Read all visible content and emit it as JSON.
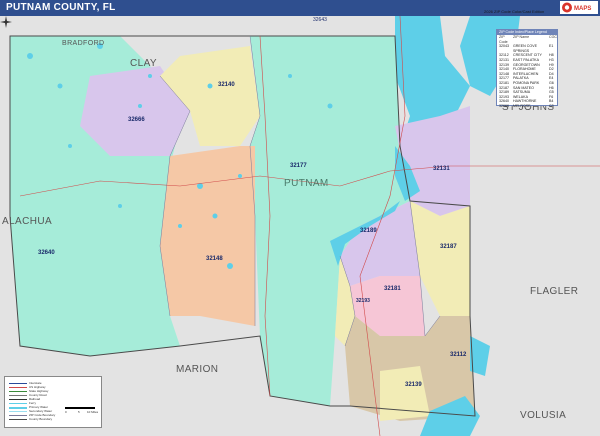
{
  "header": {
    "title": "PUTNAM COUNTY, FL",
    "edition": "2026 ZIP Code Color/Cast Edition",
    "logo_text": "MAPS"
  },
  "colors": {
    "header_bg": "#2f4f8f",
    "water": "#5ecfe8",
    "outside": "#e3e3e3",
    "teal": "#a6ecd9",
    "purple": "#d8c6ec",
    "salmon": "#f5c8a6",
    "tan": "#d8c7a8",
    "yellow": "#f2ecb6",
    "pink": "#f6c6d6"
  },
  "map": {
    "counties": [
      {
        "name": "BRADFORD"
      },
      {
        "name": "CLAY"
      },
      {
        "name": "ST JOHNS"
      },
      {
        "name": "ALACHUA"
      },
      {
        "name": "PUTNAM"
      },
      {
        "name": "FLAGLER"
      },
      {
        "name": "MARION"
      },
      {
        "name": "VOLUSIA"
      }
    ],
    "zips": [
      "32643",
      "32140",
      "32666",
      "32177",
      "32131",
      "32148",
      "32640",
      "32189",
      "32187",
      "32181",
      "32193",
      "32112",
      "32139"
    ]
  },
  "legend": {
    "heading": "ZIP Code Index/Place Legend",
    "col_code": "ZIP Code",
    "col_name": "ZIP Name",
    "col_grid": "CGC",
    "rows": [
      {
        "code": "32043",
        "name": "GREEN COVE SPRINGS",
        "grid": "E1"
      },
      {
        "code": "32112",
        "name": "CRESCENT CITY",
        "grid": "H8"
      },
      {
        "code": "32131",
        "name": "EAST PALATKA",
        "grid": "H3"
      },
      {
        "code": "32139",
        "name": "GEORGETOWN",
        "grid": "H9"
      },
      {
        "code": "32140",
        "name": "FLORAHOME",
        "grid": "D2"
      },
      {
        "code": "32148",
        "name": "INTERLACHEN",
        "grid": "D4"
      },
      {
        "code": "32177",
        "name": "PALATKA",
        "grid": "E4"
      },
      {
        "code": "32181",
        "name": "POMONA PARK",
        "grid": "G6"
      },
      {
        "code": "32187",
        "name": "SAN MATEO",
        "grid": "H6"
      },
      {
        "code": "32189",
        "name": "SATSUMA",
        "grid": "G5"
      },
      {
        "code": "32193",
        "name": "WELAKA",
        "grid": "F6"
      },
      {
        "code": "32640",
        "name": "HAWTHORNE",
        "grid": "B4"
      },
      {
        "code": "32666",
        "name": "MELROSE",
        "grid": "C3"
      }
    ]
  },
  "key": {
    "items": [
      "Interstate",
      "US Highway",
      "State Highway",
      "County Road",
      "Railroad",
      "Ferry",
      "Primary Water",
      "Secondary Water",
      "ZIP Code Boundary",
      "County Boundary"
    ],
    "scale_labels": [
      "0",
      "5",
      "10 Miles"
    ]
  }
}
